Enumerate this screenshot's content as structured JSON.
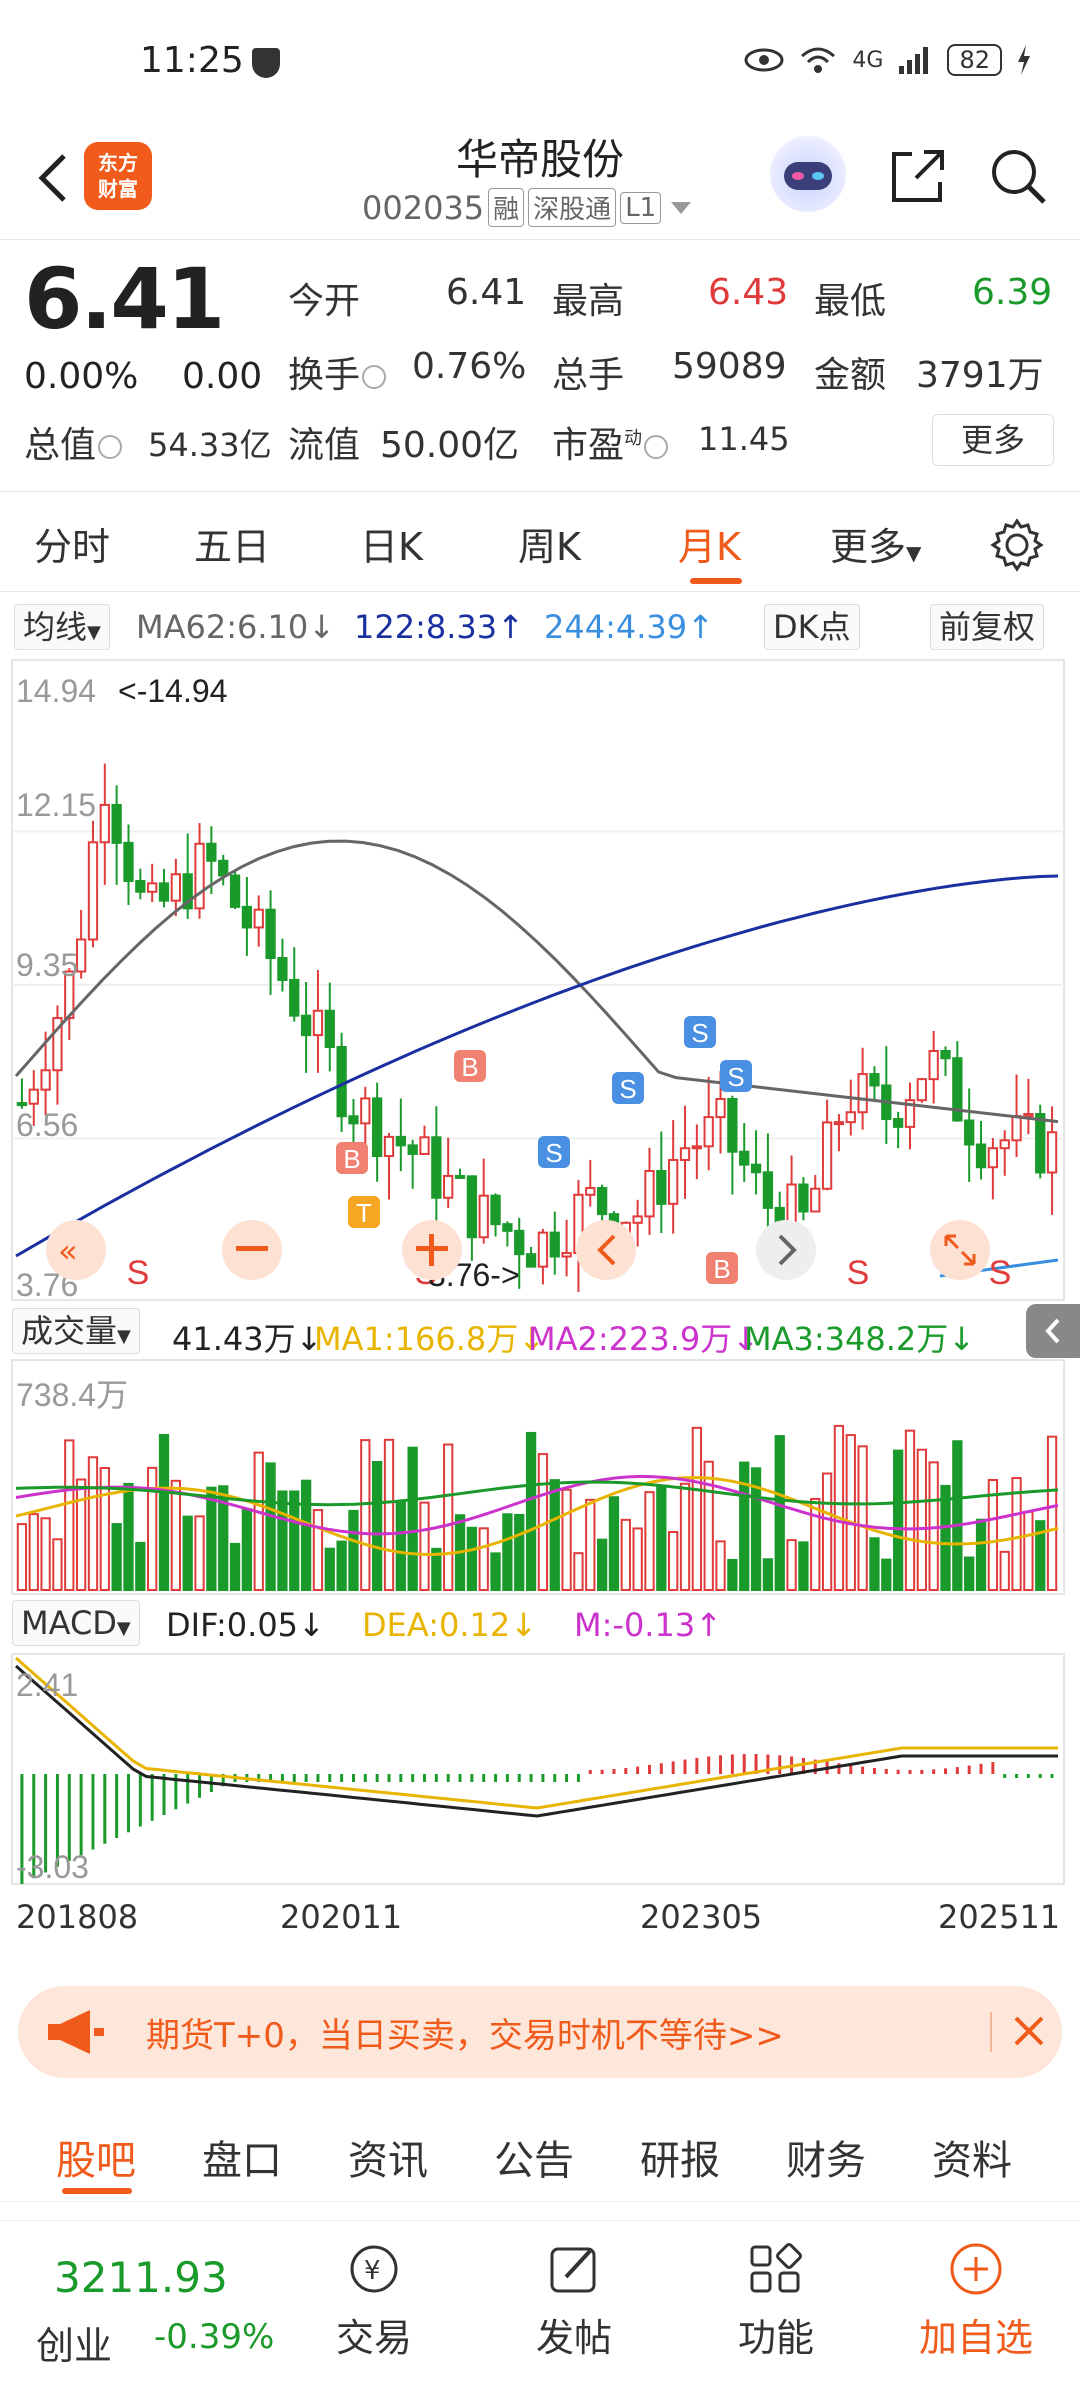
{
  "status_bar": {
    "time": "11:25",
    "network": "4G",
    "battery": "82"
  },
  "header": {
    "logo_line1": "东方",
    "logo_line2": "财富",
    "stock_name": "华帝股份",
    "stock_code": "002035",
    "tags": [
      "融",
      "深股通",
      "L1"
    ]
  },
  "quote": {
    "price": "6.41",
    "change_pct": "0.00%",
    "change_abs": "0.00",
    "open_label": "今开",
    "open": "6.41",
    "high_label": "最高",
    "high": "6.43",
    "low_label": "最低",
    "low": "6.39",
    "turnover_label": "换手",
    "turnover": "0.76%",
    "volume_label": "总手",
    "volume": "59089",
    "amount_label": "金额",
    "amount": "3791万",
    "mktcap_label": "总值",
    "mktcap": "54.33亿",
    "float_label": "流值",
    "float": "50.00亿",
    "pe_label": "市盈",
    "pe_sup": "动",
    "pe": "11.45",
    "more": "更多"
  },
  "k_tabs": [
    "分时",
    "五日",
    "日K",
    "周K",
    "月K",
    "更多"
  ],
  "active_k_tab": "月K",
  "ma_row": {
    "selector": "均线",
    "ma62": "MA62:6.10",
    "ma122": "122:8.33",
    "ma244": "244:4.39",
    "dk_button": "DK点",
    "adjust_button": "前复权"
  },
  "chart_data": {
    "type": "candlestick",
    "period": "monthly",
    "x_ticks": [
      "201808",
      "202011",
      "202305",
      "202511"
    ],
    "y_ticks": [
      "14.94",
      "12.15",
      "9.35",
      "6.56",
      "3.76"
    ],
    "ylim": [
      3.76,
      14.94
    ],
    "max_label": "<-14.94",
    "min_label": "3.76->",
    "signals": [
      "B",
      "T",
      "B",
      "S",
      "S",
      "S",
      "S",
      "B",
      "S",
      "S",
      "S",
      "S"
    ],
    "lines": [
      {
        "name": "MA62",
        "color": "#666666"
      },
      {
        "name": "122",
        "color": "#1a2fa0"
      },
      {
        "name": "244",
        "color": "#3a8ee0"
      }
    ],
    "volume": {
      "label": "成交量",
      "value": "41.43万",
      "ma1": "MA1:166.8万",
      "ma2": "MA2:223.9万",
      "ma3": "MA3:348.2万",
      "ymax": "738.4万"
    },
    "macd": {
      "label": "MACD",
      "dif": "DIF:0.05",
      "dea": "DEA:0.12",
      "m": "M:-0.13",
      "ymax": "2.41",
      "ymin": "-3.03"
    }
  },
  "banner": {
    "text": "期货T+0，当日买卖，交易时机不等待>>"
  },
  "bottom_tabs": [
    "股吧",
    "盘口",
    "资讯",
    "公告",
    "研报",
    "财务",
    "资料"
  ],
  "active_bottom_tab": "股吧",
  "bottom_bar": {
    "index_value": "3211.93",
    "index_name": "创业",
    "index_change": "-0.39%",
    "items": [
      "交易",
      "发帖",
      "功能",
      "加自选"
    ]
  },
  "colors": {
    "accent": "#f05a1a",
    "up": "#e03a3a",
    "down": "#1a9a2a"
  }
}
